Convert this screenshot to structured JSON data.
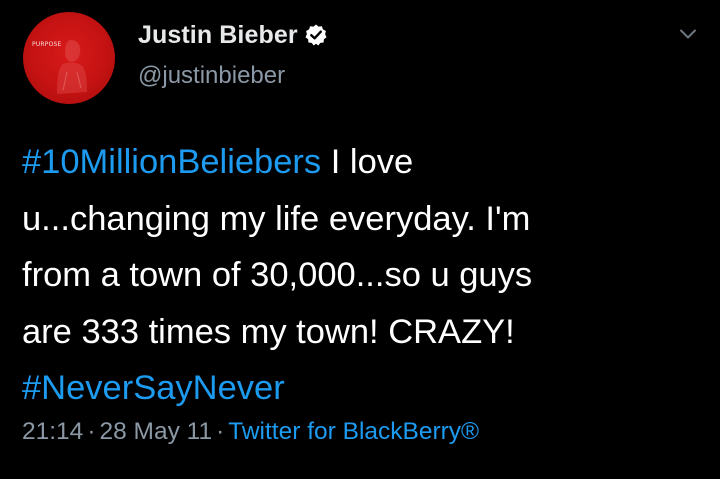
{
  "author": {
    "display_name": "Justin Bieber",
    "handle": "@justinbieber",
    "verified": true,
    "avatar_text": "PURPOSE"
  },
  "tweet": {
    "hashtag_1": "#10MillionBeliebers",
    "text_1": " I love\nu...changing my life everyday. I'm\nfrom a town of 30,000...so u guys\nare 333 times my town! CRAZY!\n",
    "hashtag_2": "#NeverSayNever"
  },
  "meta": {
    "time": "21:14",
    "separator_1": "·",
    "date": "28 May 11",
    "separator_2": "·",
    "source": "Twitter for BlackBerry®"
  },
  "colors": {
    "background": "#000000",
    "text": "#ffffff",
    "secondary_text": "#8b98a5",
    "link": "#1d9bf0",
    "avatar_bg": "#c41212"
  },
  "icons": {
    "verified": "verified-badge-icon",
    "menu": "chevron-down-icon"
  }
}
